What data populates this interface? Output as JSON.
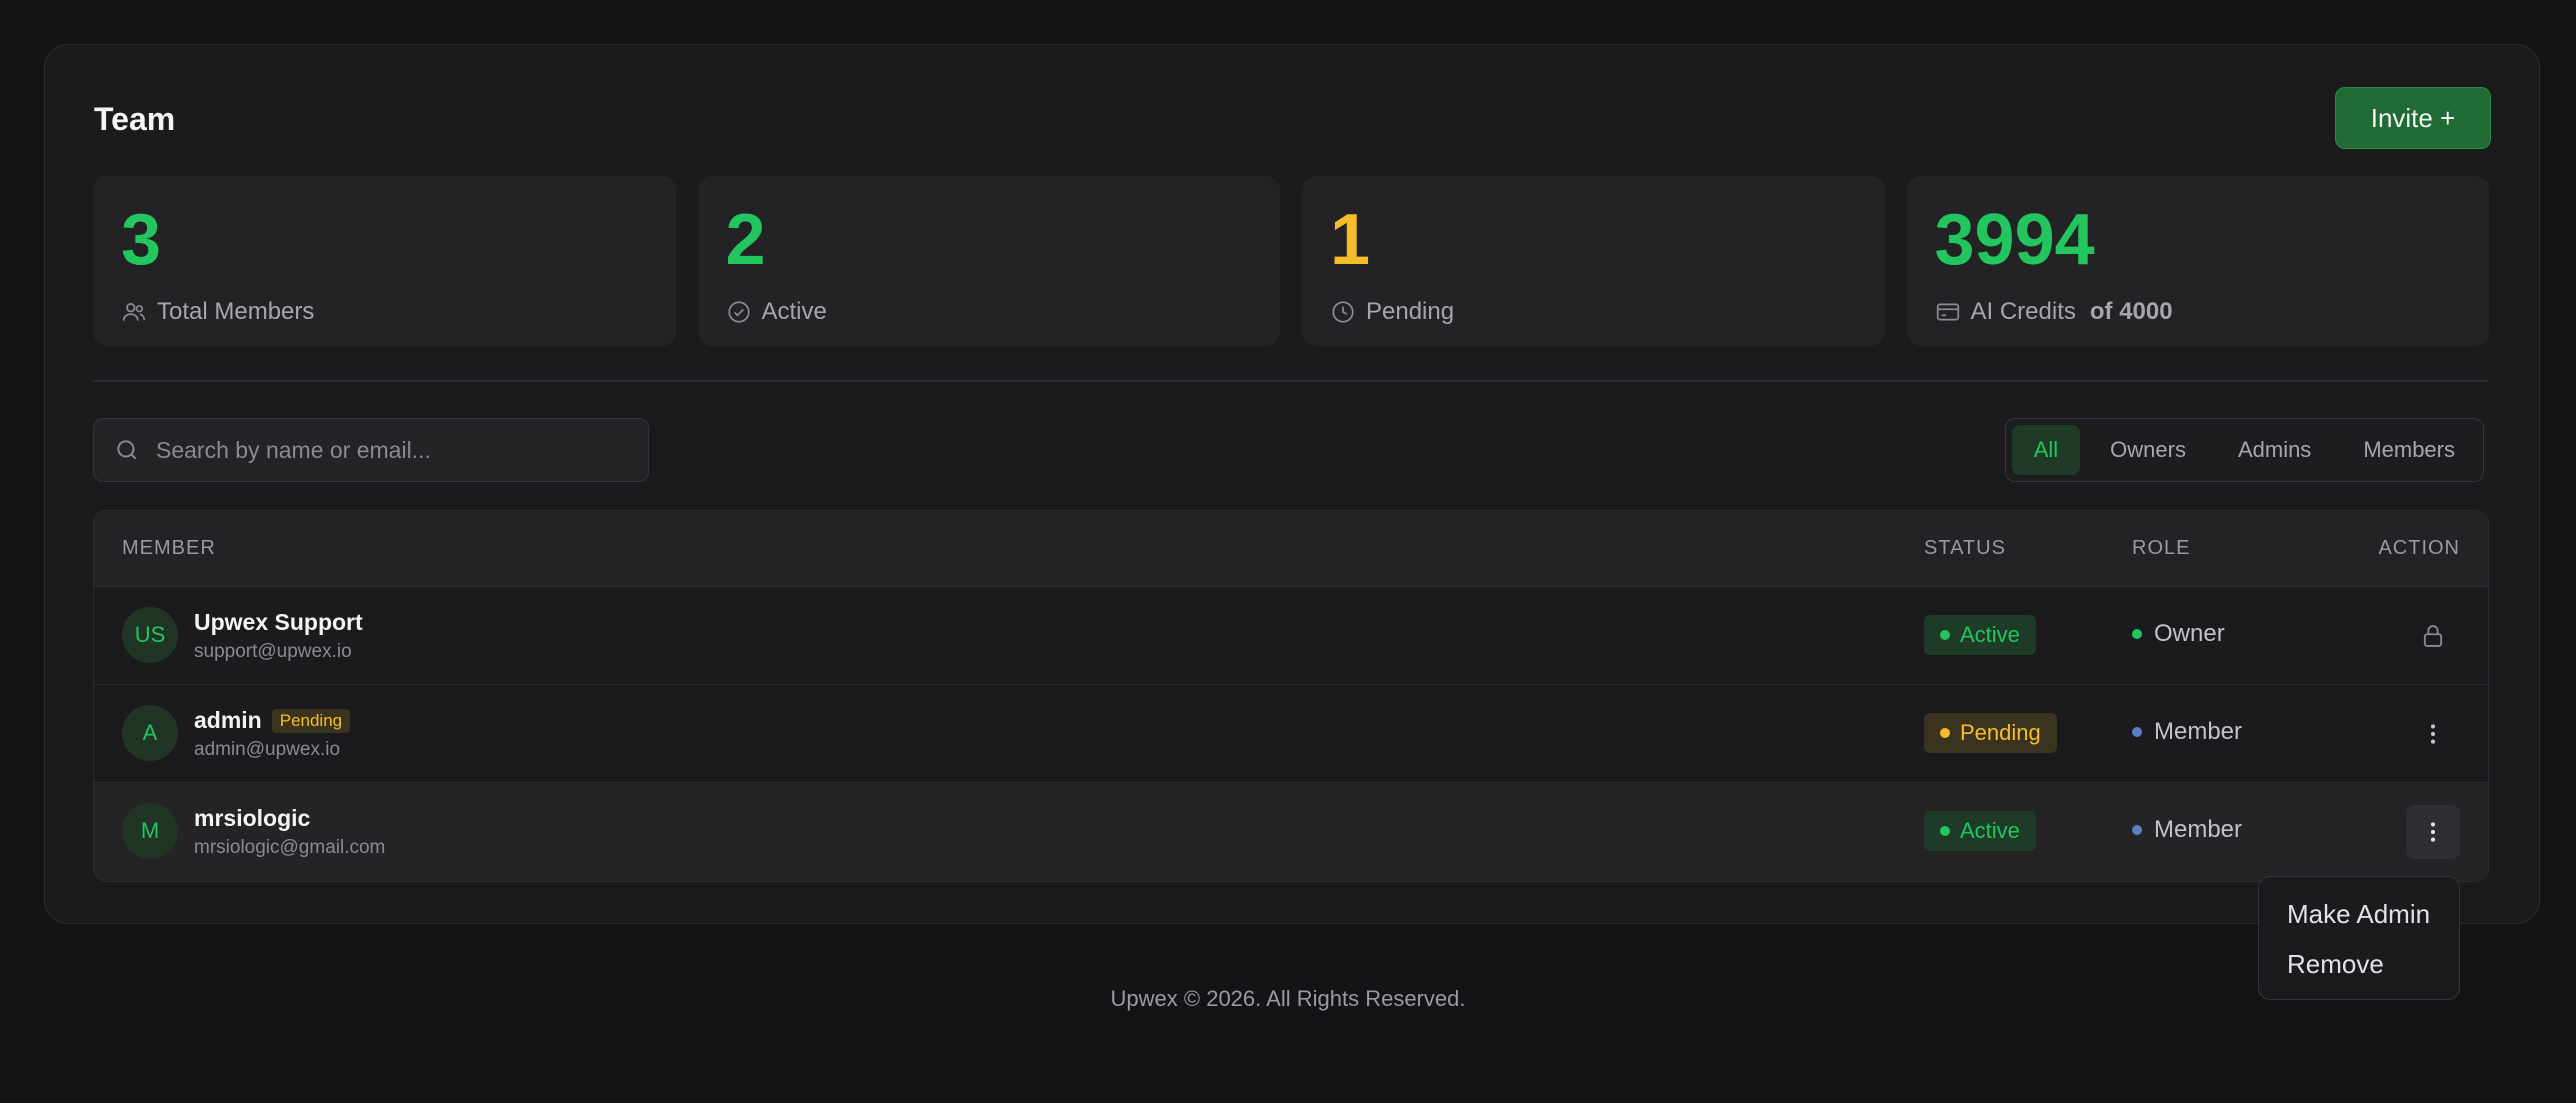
{
  "header": {
    "title": "Team",
    "invite_label": "Invite +"
  },
  "stats": [
    {
      "value": "3",
      "label": "Total Members",
      "icon": "users-icon",
      "color": "#22c55e"
    },
    {
      "value": "2",
      "label": "Active",
      "icon": "check-circle-icon",
      "color": "#22c55e"
    },
    {
      "value": "1",
      "label": "Pending",
      "icon": "clock-icon",
      "color": "#f6bd2b"
    },
    {
      "value": "3994",
      "label": "AI Credits",
      "suffix": "of 4000",
      "icon": "credit-card-icon",
      "color": "#22c55e"
    }
  ],
  "search": {
    "placeholder": "Search by name or email...",
    "value": ""
  },
  "filters": {
    "items": [
      "All",
      "Owners",
      "Admins",
      "Members"
    ],
    "selected": "All"
  },
  "table": {
    "columns": {
      "member": "MEMBER",
      "status": "STATUS",
      "role": "ROLE",
      "action": "ACTION"
    },
    "rows": [
      {
        "initials": "US",
        "name": "Upwex Support",
        "email": "support@upwex.io",
        "tag": "",
        "status": "Active",
        "role": "Owner",
        "action_icon": "lock-icon"
      },
      {
        "initials": "A",
        "name": "admin",
        "email": "admin@upwex.io",
        "tag": "Pending",
        "status": "Pending",
        "role": "Member",
        "action_icon": "more-vertical-icon"
      },
      {
        "initials": "M",
        "name": "mrsiologic",
        "email": "mrsiologic@gmail.com",
        "tag": "",
        "status": "Active",
        "role": "Member",
        "action_icon": "more-vertical-icon"
      }
    ]
  },
  "dropdown": {
    "items": [
      "Make Admin",
      "Remove"
    ]
  },
  "footer": {
    "text": "Upwex © 2026. All Rights Reserved."
  },
  "colors": {
    "accent": "#22c55e",
    "warning": "#f6bd2b",
    "member_role": "#5b7fc4",
    "button": "#1f6a35"
  }
}
